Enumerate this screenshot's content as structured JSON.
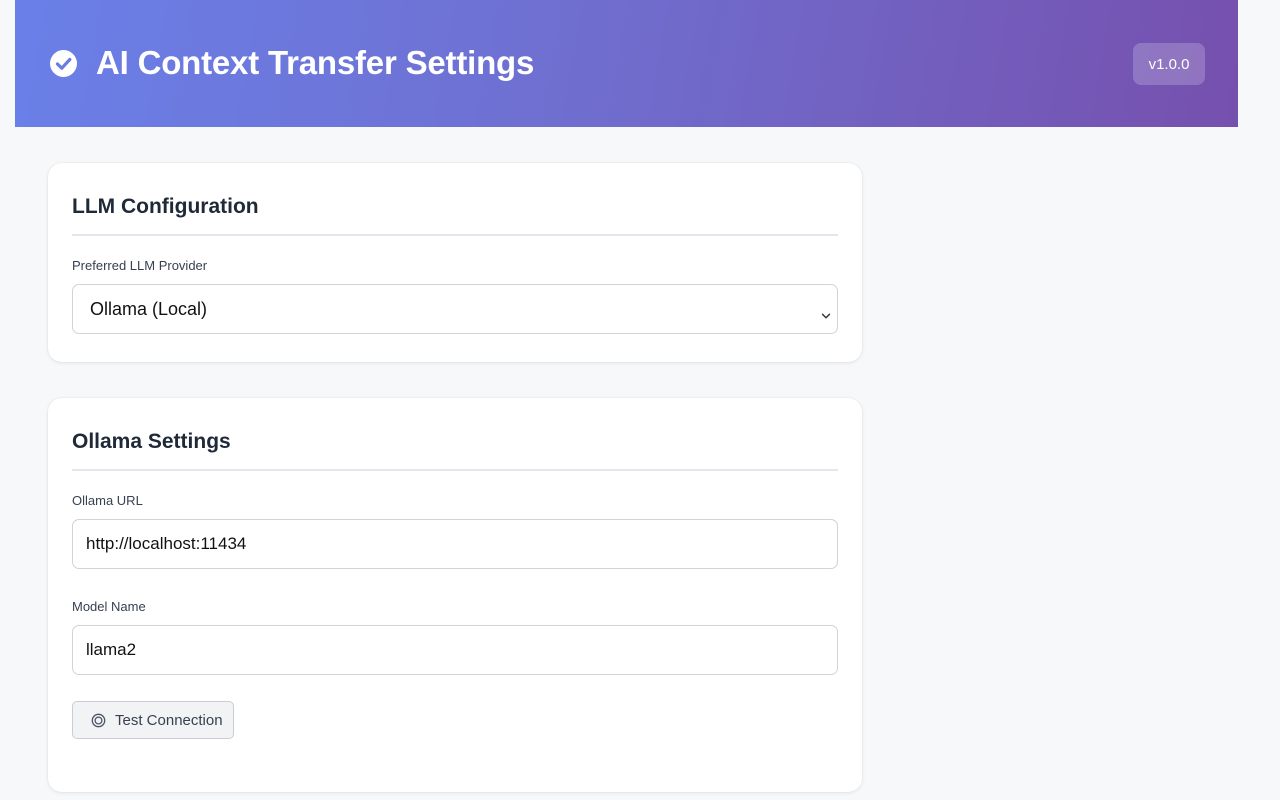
{
  "header": {
    "title": "AI Context Transfer Settings",
    "version": "v1.0.0",
    "icon": "check-circle-icon"
  },
  "llm_config": {
    "title": "LLM Configuration",
    "provider_label": "Preferred LLM Provider",
    "provider_value": "Ollama (Local)"
  },
  "ollama": {
    "title": "Ollama Settings",
    "url_label": "Ollama URL",
    "url_value": "http://localhost:11434",
    "model_label": "Model Name",
    "model_value": "llama2",
    "test_button_label": "Test Connection",
    "test_button_icon": "target-icon"
  },
  "colors": {
    "header_gradient_start": "#6a80e8",
    "header_gradient_end": "#7650ae",
    "background": "#f7f8fa",
    "card": "#ffffff"
  }
}
